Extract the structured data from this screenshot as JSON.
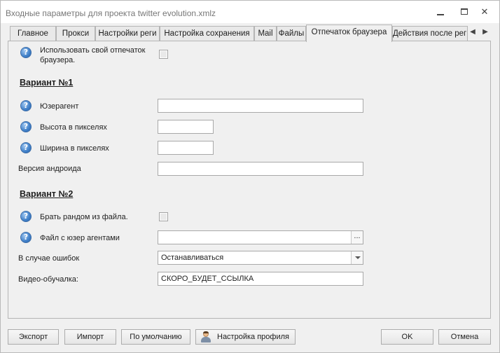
{
  "window": {
    "title": "Входные параметры для проекта twitter evolution.xmlz",
    "minimize_icon": "minimize-icon",
    "maximize_icon": "maximize-icon",
    "close_glyph": "✕"
  },
  "tabs": [
    {
      "label": "Главное",
      "active": false
    },
    {
      "label": "Прокси",
      "active": false
    },
    {
      "label": "Настройки реги",
      "active": false
    },
    {
      "label": "Настройка сохранения",
      "active": false
    },
    {
      "label": "Mail",
      "active": false
    },
    {
      "label": "Файлы",
      "active": false
    },
    {
      "label": "Отпечаток браузера",
      "active": true
    },
    {
      "label": "Действия после реги",
      "active": false
    }
  ],
  "tab_scroll": {
    "left": "◀",
    "right": "▶"
  },
  "form": {
    "help_glyph": "?",
    "use_own_fingerprint": {
      "label_line1": "Использовать свой отпечаток",
      "label_line2": "браузера.",
      "checked": false
    },
    "variant1_title": "Вариант №1",
    "useragent": {
      "label": "Юзерагент",
      "value": ""
    },
    "height": {
      "label": "Высота в пикселях",
      "value": ""
    },
    "width": {
      "label": "Ширина в пикселях",
      "value": ""
    },
    "android_version": {
      "label": "Версия андроида",
      "value": ""
    },
    "variant2_title": "Вариант №2",
    "random_from_file": {
      "label": "Брать рандом из файла.",
      "checked": false
    },
    "useragents_file": {
      "label": "Файл с юзер агентами",
      "value": "",
      "browse_label": "..."
    },
    "on_error": {
      "label": "В случае ошибок",
      "selected": "Останавливаться"
    },
    "video_tutorial": {
      "label": "Видео-обучалка:",
      "value": "СКОРО_БУДЕТ_ССЫЛКА"
    }
  },
  "buttons": {
    "export": "Экспорт",
    "import": "Импорт",
    "defaults": "По умолчанию",
    "profile_settings": "Настройка профиля",
    "ok": "OK",
    "cancel": "Отмена"
  }
}
